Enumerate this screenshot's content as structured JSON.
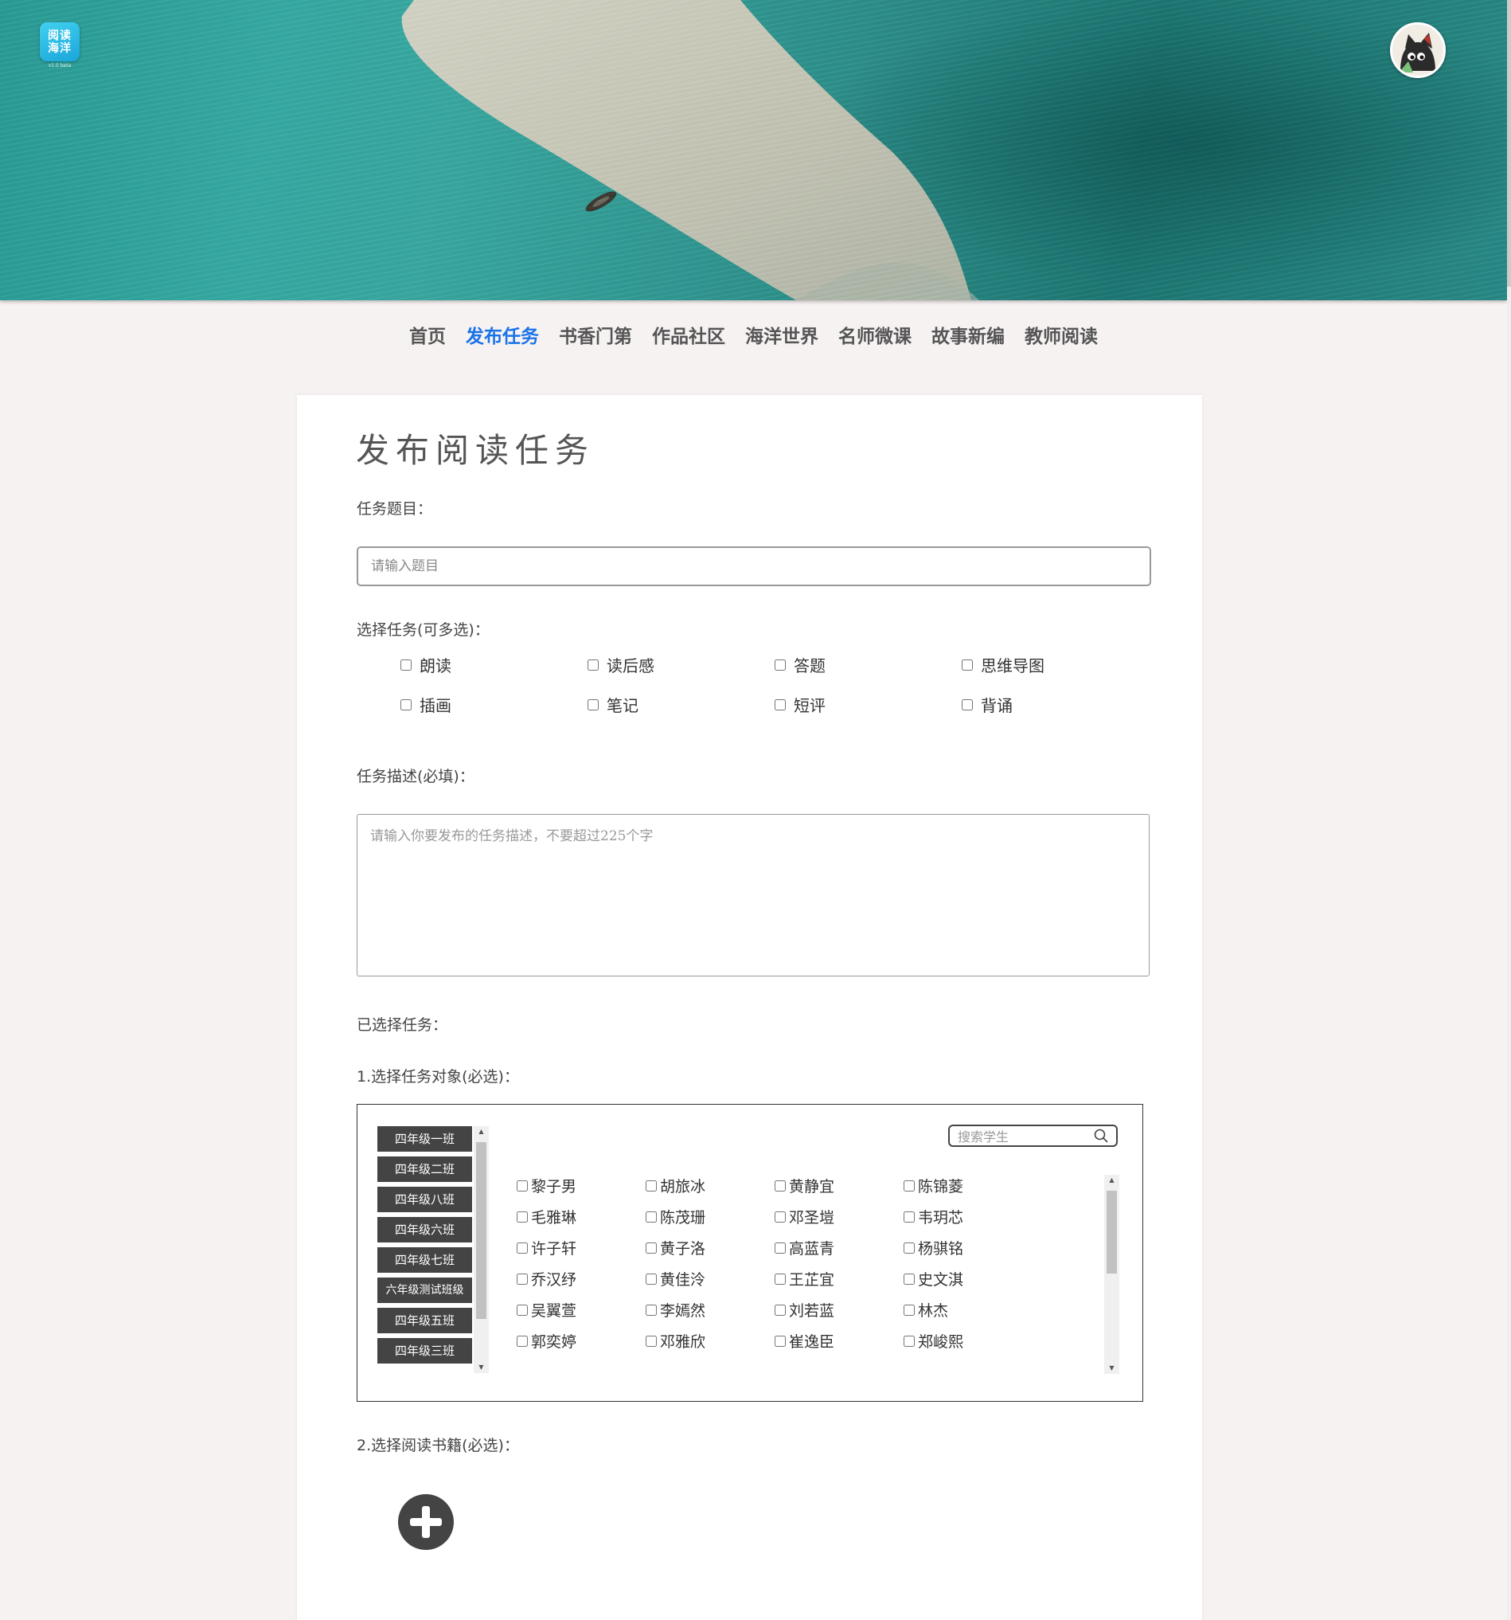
{
  "header": {
    "logo_line1": "阅读",
    "logo_line2": "海洋",
    "logo_version": "v1.0 beta",
    "avatar_icon": "cat-avatar-icon"
  },
  "nav": {
    "items": [
      {
        "label": "首页",
        "active": false
      },
      {
        "label": "发布任务",
        "active": true
      },
      {
        "label": "书香门第",
        "active": false
      },
      {
        "label": "作品社区",
        "active": false
      },
      {
        "label": "海洋世界",
        "active": false
      },
      {
        "label": "名师微课",
        "active": false
      },
      {
        "label": "故事新编",
        "active": false
      },
      {
        "label": "教师阅读",
        "active": false
      }
    ],
    "active_color": "#1a73e8"
  },
  "form": {
    "page_title": "发布阅读任务",
    "title_label": "任务题目：",
    "title_placeholder": "请输入题目",
    "tasks_label": "选择任务(可多选)：",
    "tasks": [
      "朗读",
      "读后感",
      "答题",
      "思维导图",
      "插画",
      "笔记",
      "短评",
      "背诵"
    ],
    "desc_label": "任务描述(必填)：",
    "desc_placeholder": "请输入你要发布的任务描述，不要超过225个字",
    "selected_label": "已选择任务：",
    "target_label": "1.选择任务对象(必选)：",
    "classes": [
      "四年级一班",
      "四年级二班",
      "四年级八班",
      "四年级六班",
      "四年级七班",
      "六年级测试班级",
      "四年级五班",
      "四年级三班"
    ],
    "search_placeholder": "搜索学生",
    "students": [
      "黎子男",
      "胡旅冰",
      "黄静宜",
      "陈锦菱",
      "毛雅琳",
      "陈茂珊",
      "邓圣塏",
      "韦玥芯",
      "许子轩",
      "黄子洛",
      "高蓝青",
      "杨骐铭",
      "乔汉纾",
      "黄佳泠",
      "王芷宜",
      "史文淇",
      "吴翼萱",
      "李嫣然",
      "刘若蓝",
      "林杰",
      "郭奕婷",
      "邓雅欣",
      "崔逸臣",
      "郑峻熙"
    ],
    "book_label": "2.选择阅读书籍(必选)："
  }
}
